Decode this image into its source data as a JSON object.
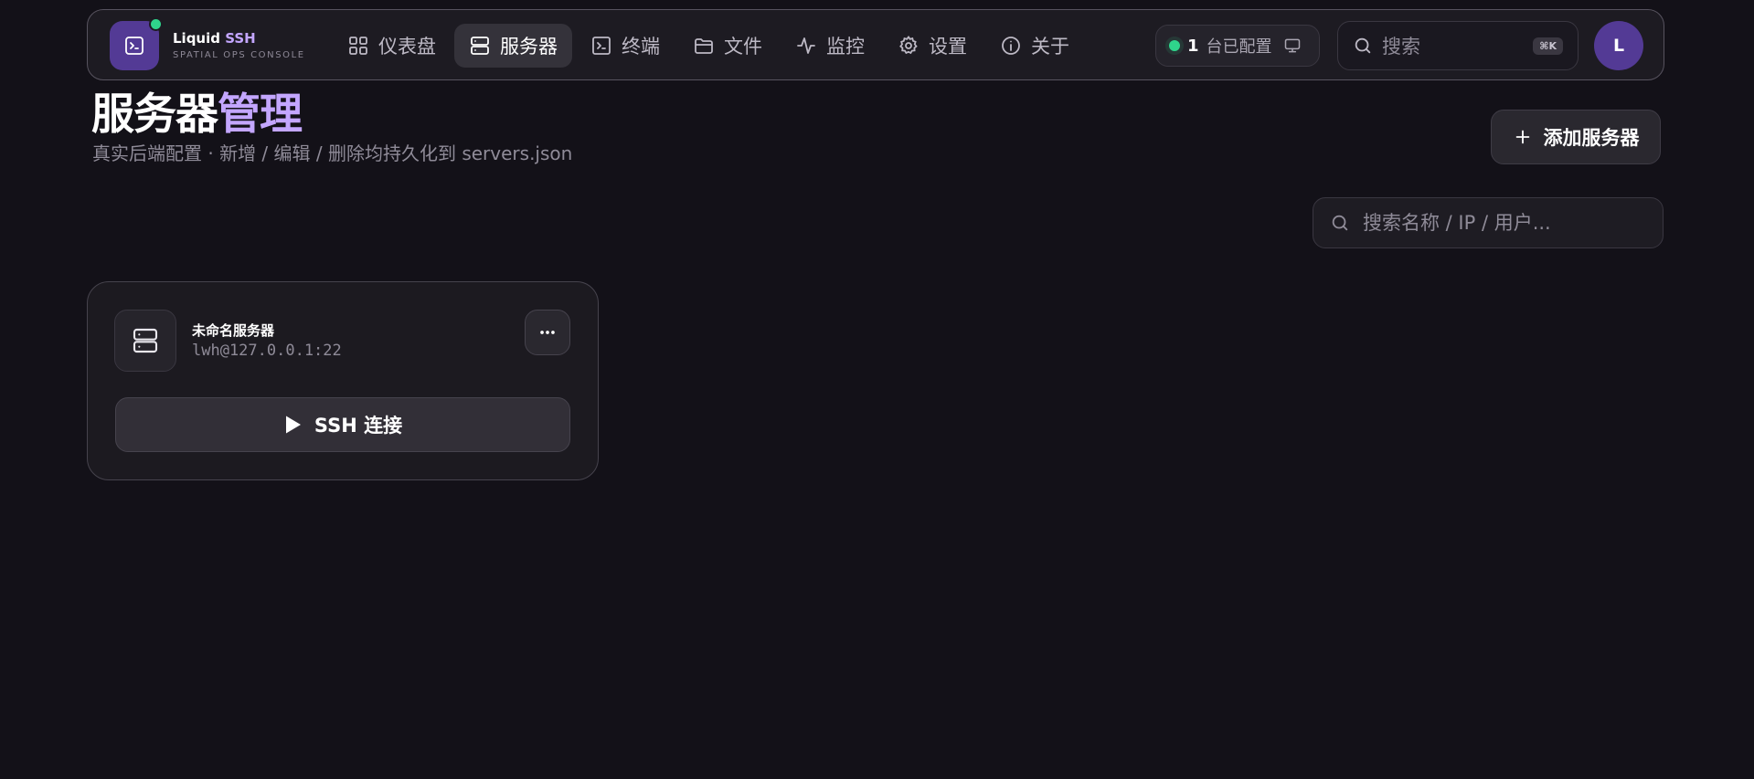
{
  "app": {
    "brand_name": "Liquid",
    "brand_accent": "SSH",
    "brand_subtitle": "SPATIAL OPS CONSOLE",
    "logo_icon": "terminal-icon",
    "status_dot_color": "#2fd48b",
    "accent_color": "#c3a6ff",
    "brand_color": "#533a95"
  },
  "nav": {
    "items": [
      {
        "label": "仪表盘",
        "icon": "grid-icon",
        "active": false
      },
      {
        "label": "服务器",
        "icon": "server-icon",
        "active": true
      },
      {
        "label": "终端",
        "icon": "terminal-icon",
        "active": false
      },
      {
        "label": "文件",
        "icon": "folder-icon",
        "active": false
      },
      {
        "label": "监控",
        "icon": "activity-icon",
        "active": false
      },
      {
        "label": "设置",
        "icon": "gear-icon",
        "active": false
      },
      {
        "label": "关于",
        "icon": "info-icon",
        "active": false
      }
    ]
  },
  "header": {
    "status_count": "1",
    "status_text": "台已配置",
    "search_placeholder": "搜索",
    "search_shortcut": "⌘K",
    "avatar_initial": "L"
  },
  "page": {
    "title_main": "服务器",
    "title_accent": "管理",
    "subtitle": "真实后端配置 · 新增 / 编辑 / 删除均持久化到 servers.json",
    "add_button_label": "添加服务器",
    "search_placeholder": "搜索名称 / IP / 用户..."
  },
  "servers": [
    {
      "name": "未命名服务器",
      "address": "lwh@127.0.0.1:22",
      "connect_label": "SSH 连接"
    }
  ]
}
